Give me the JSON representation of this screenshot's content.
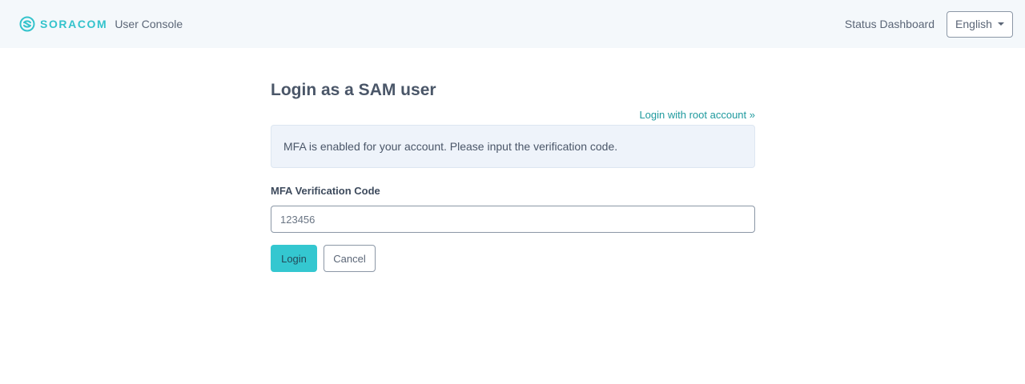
{
  "header": {
    "brand": "SORACOM",
    "console_label": "User Console",
    "status_link": "Status Dashboard",
    "language": "English"
  },
  "main": {
    "title": "Login as a SAM user",
    "root_link": "Login with root account »",
    "alert": "MFA is enabled for your account. Please input the verification code.",
    "mfa_label": "MFA Verification Code",
    "mfa_placeholder": "123456",
    "login_label": "Login",
    "cancel_label": "Cancel"
  },
  "colors": {
    "brand": "#34c3cc",
    "primary_button": "#34c7d0",
    "link": "#1f9a9e",
    "header_bg": "#f4f8fb",
    "alert_bg": "#eef3fa"
  },
  "icons": {
    "logo": "soracom-logo-icon",
    "language_dropdown": "caret-down-icon"
  }
}
